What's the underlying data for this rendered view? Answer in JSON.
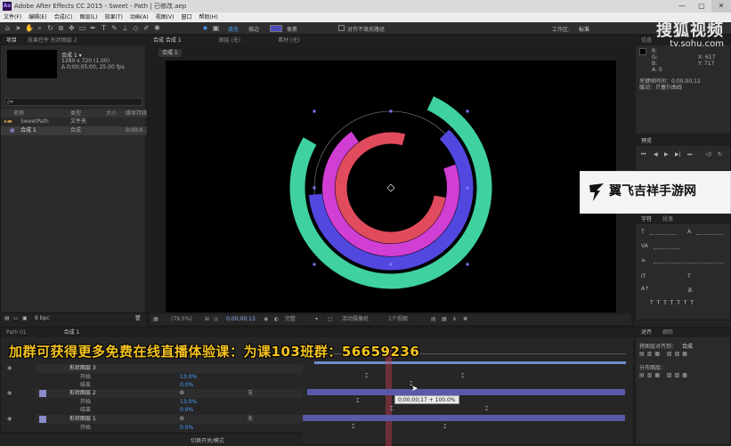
{
  "window": {
    "title": "Adobe After Effects CC 2015 - Sweet - Path | 已修改.aep",
    "minimize": "—",
    "maximize": "▢",
    "close": "✕"
  },
  "menu": [
    "文件(F)",
    "编辑(E)",
    "合成(C)",
    "图层(L)",
    "效果(T)",
    "动画(A)",
    "视图(V)",
    "窗口",
    "帮助(H)"
  ],
  "toolbar": {
    "workspace_label": "工作区:",
    "workspace_value": "标准",
    "mode_labels": [
      "填充",
      "描边",
      "像素"
    ],
    "snap_label": "对齐不填充路径"
  },
  "project_panel": {
    "tabs": [
      "项目",
      "效果控件 形状图层 2"
    ],
    "preview_name": "合成 1 ▾",
    "preview_info": [
      "1280 x 720 (1.00)",
      "Δ 0;00;05;00, 25.00 fps"
    ],
    "search_placeholder": "ρ▾",
    "columns": [
      "名称",
      "类型",
      "大小",
      "媒体持续"
    ],
    "items": [
      {
        "name": "SweetPath",
        "type": "文件夹",
        "size": "",
        "duration": ""
      },
      {
        "name": "合成 1",
        "type": "合成",
        "size": "",
        "duration": "0;00;0"
      }
    ],
    "footer_label": "8 bpc"
  },
  "composition_panel": {
    "tabs": [
      "合成 合成 1",
      "图层 (无)",
      "素材 (无)"
    ],
    "breadcrumb": "合成 1",
    "footer": {
      "zoom": "(79.5%)",
      "timecode": "0;00;00;13",
      "quality": "完整",
      "camera": "活动摄像机",
      "views": "1个视图"
    }
  },
  "right_panel": {
    "info_lines": [
      "R:",
      "G:",
      "B:",
      "A: 0",
      "X: 617",
      "Y: 717"
    ],
    "status_lines": [
      "关键帧时间：0;00;00;12",
      "缓动：贝塞尔曲线"
    ],
    "preview_tab": "预览",
    "text_tabs": [
      "字符",
      "段落"
    ],
    "tracker_tabs": [
      "对齐",
      "跟踪"
    ],
    "tracker_labels": [
      "将图层对齐到：",
      "合成",
      "分布图层："
    ]
  },
  "timeline": {
    "tabs": [
      "Path 01",
      "合成 1"
    ],
    "current_time": "0;00;00;13",
    "layers": [
      {
        "name": "形状图层 3",
        "sub": [
          "开始",
          "结束"
        ],
        "values": [
          "13.0%",
          "0.0%"
        ]
      },
      {
        "name": "形状图层 2",
        "sub": [
          "开始",
          "结束"
        ],
        "values": [
          "13.0%",
          "0.0%"
        ]
      },
      {
        "name": "形状图层 1",
        "sub": [
          "开始"
        ],
        "values": [
          "0.0%"
        ]
      }
    ],
    "parent_value": "无",
    "footer_toggle": "切换开关/模式",
    "tooltip": "0;00;00;17 + 100.0%",
    "ruler_labels": [
      "",
      "",
      "",
      "",
      "",
      ""
    ]
  },
  "overlays": {
    "banner": "加群可获得更多免费在线直播体验课：为课103班群：56659236",
    "sohu_cn": "搜狐视频",
    "sohu_url": "tv.sohu.com",
    "ad_text": "翼飞吉祥手游网"
  },
  "colors": {
    "ring_outer": "#3fd1a0",
    "ring_blue": "#5248e0",
    "ring_magenta": "#d03ed4",
    "ring_red": "#e04b5e",
    "timeline_bar": "#5a5aa8",
    "banner_text": "#f4c320"
  }
}
